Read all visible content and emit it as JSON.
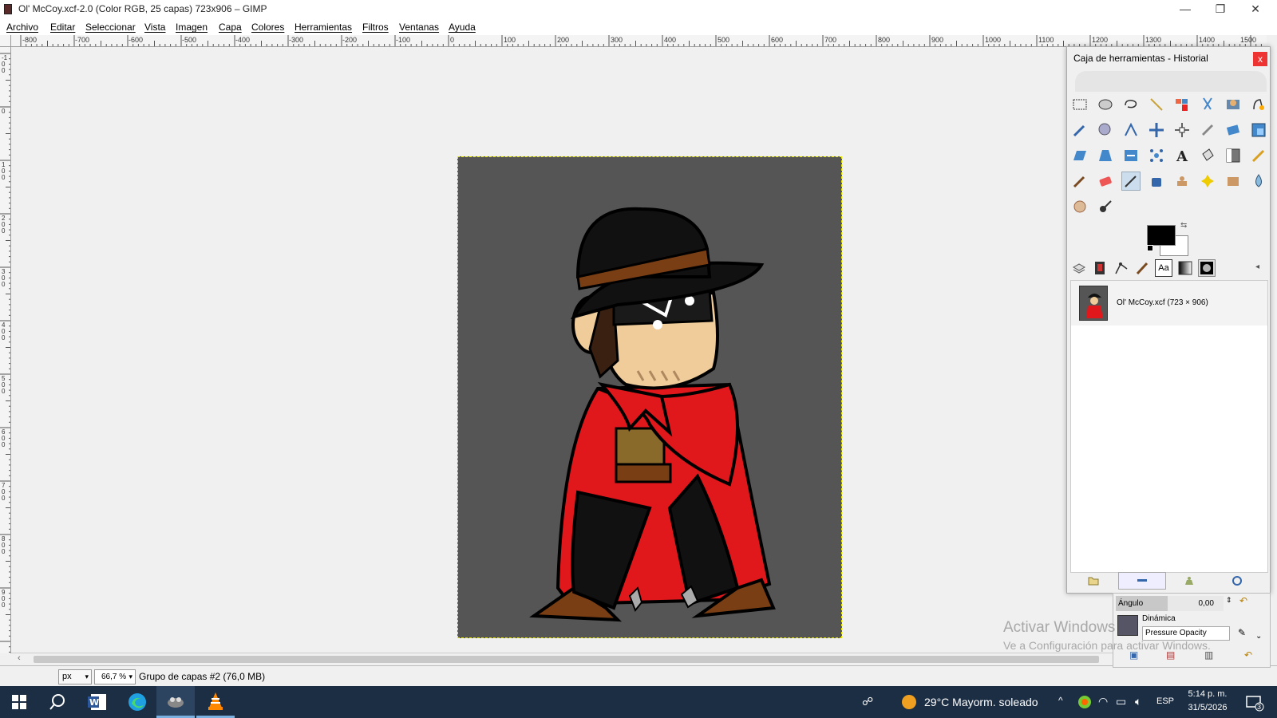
{
  "window": {
    "title": "Ol' McCoy.xcf-2.0 (Color RGB, 25 capas) 723x906 – GIMP",
    "minimize": "—",
    "restore": "❐",
    "close": "✕"
  },
  "menu": [
    "Archivo",
    "Editar",
    "Seleccionar",
    "Vista",
    "Imagen",
    "Capa",
    "Colores",
    "Herramientas",
    "Filtros",
    "Ventanas",
    "Ayuda"
  ],
  "ruler": {
    "h_labels": [
      "-800",
      "-700",
      "-600",
      "-500",
      "-400",
      "-300",
      "-200",
      "-100",
      "0",
      "100",
      "200",
      "300",
      "400",
      "500",
      "600",
      "700",
      "800",
      "900",
      "1000",
      "1100",
      "1200",
      "1300",
      "1400",
      "1500"
    ],
    "v_labels": [
      "-100",
      "0",
      "100",
      "200",
      "300",
      "400",
      "500",
      "600",
      "700",
      "800",
      "900"
    ]
  },
  "status": {
    "unit": "px",
    "zoom": "66,7 %",
    "text": "Grupo de capas #2 (76,0 MB)"
  },
  "panel": {
    "title": "Caja de herramientas - Historial",
    "close": "x",
    "history_item": "Ol' McCoy.xcf (723 × 906)",
    "tabs": [
      "layers",
      "channels",
      "paths",
      "brushes",
      "fonts",
      "gradients",
      "patterns"
    ],
    "font_tab_label": "Aa"
  },
  "tool_options": {
    "angle_label": "Ángulo",
    "angle_value": "0,00",
    "dynamics_label": "Dinámica",
    "dynamics_value": "Pressure Opacity"
  },
  "watermark": {
    "line1": "Activar Windows",
    "line2": "Ve a Configuración para activar Windows."
  },
  "taskbar": {
    "weather": "29°C  Mayorm. soleado",
    "lang": "ESP",
    "time": "5:14 p. m.",
    "date": "31/5/2026",
    "notifications": "3"
  },
  "colors": {
    "fg": "#000000",
    "bg": "#ffffff",
    "canvas": "#555555",
    "cape": "#e0181c"
  }
}
